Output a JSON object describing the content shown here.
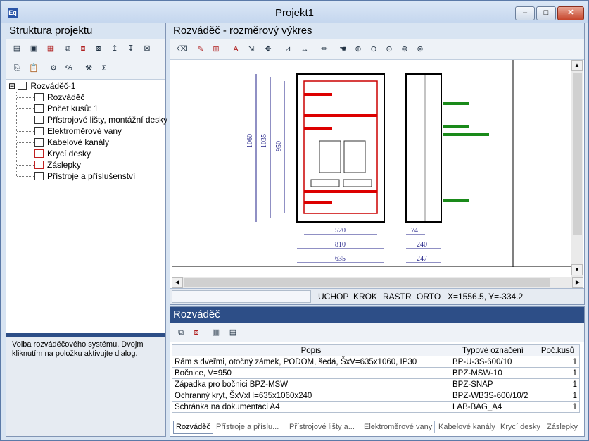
{
  "window": {
    "title": "Projekt1",
    "minimize": "–",
    "maximize": "□",
    "close": "✕",
    "app_icon": "Eq"
  },
  "left_panel": {
    "title": "Struktura projektu",
    "toolbar_icons": [
      "sheet-icon",
      "sheet2-icon",
      "grid-icon",
      "copy-icon",
      "multi-icon",
      "multi2-icon",
      "move-up-icon",
      "move-down-icon",
      "delete-icon"
    ],
    "toolbar2": {
      "percent": "%",
      "sum": "Σ"
    },
    "tree": [
      {
        "label": "Rozváděč-1",
        "icon": "cabinet-icon",
        "toggle": "⊟"
      },
      {
        "label": "Rozváděč",
        "icon": "cabinet-icon"
      },
      {
        "label": "Počet kusů: 1",
        "icon": "cabinet-icon"
      },
      {
        "label": "Přístrojové lišty, montážní desky",
        "icon": "rail-icon"
      },
      {
        "label": "Elektroměrové vany",
        "icon": "meter-tray-icon"
      },
      {
        "label": "Kabelové kanály",
        "icon": "cable-duct-icon"
      },
      {
        "label": "Krycí desky",
        "icon": "cover-plate-icon"
      },
      {
        "label": "Záslepky",
        "icon": "blank-icon"
      },
      {
        "label": "Přístroje a příslušenství",
        "icon": "devices-icon"
      }
    ],
    "hint": "Volba rozváděčového systému. Dvojm kliknutím na položku aktivujte dialog."
  },
  "drawing_panel": {
    "title": "Rozváděč - rozměrový výkres",
    "dims": {
      "h1": "1060",
      "h2": "1035",
      "h3": "950",
      "w1": "520",
      "w2": "810",
      "w3": "635",
      "d1": "74",
      "d2": "240",
      "d3": "247"
    },
    "status": {
      "snap": "UCHOP",
      "step": "KROK",
      "grid": "RASTR",
      "ortho": "ORTO",
      "coords": "X=1556.5, Y=-334.2"
    }
  },
  "bottom_panel": {
    "title": "Rozváděč",
    "columns": [
      "Popis",
      "Typové označení",
      "Poč.kusů"
    ],
    "rows": [
      [
        "Rám s dveřmi, otočný zámek, PODOM, šedá, ŠxV=635x1060, IP30",
        "BP-U-3S-600/10",
        "1"
      ],
      [
        "Bočnice, V=950",
        "BPZ-MSW-10",
        "1"
      ],
      [
        "Západka pro bočnici BPZ-MSW",
        "BPZ-SNAP",
        "1"
      ],
      [
        "Ochranný kryt, ŠxVxH=635x1060x240",
        "BPZ-WB3S-600/10/2",
        "1"
      ],
      [
        "Schránka na dokumentaci A4",
        "LAB-BAG_A4",
        "1"
      ]
    ],
    "tabs": [
      "Rozváděč",
      "Přístroje a příslu...",
      "Přístrojové lišty a...",
      "Elektroměrové vany",
      "Kabelové kanály",
      "Krycí desky",
      "Záslepky"
    ]
  }
}
